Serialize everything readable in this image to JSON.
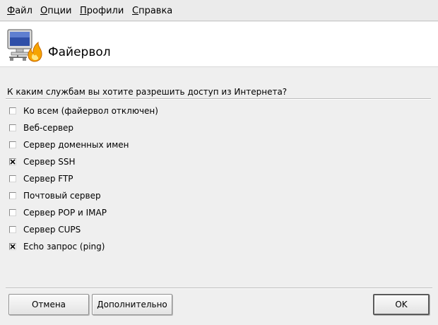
{
  "menu": {
    "items": [
      {
        "first": "Ф",
        "rest": "айл"
      },
      {
        "first": "О",
        "rest": "пции"
      },
      {
        "first": "П",
        "rest": "рофили"
      },
      {
        "first": "С",
        "rest": "правка"
      }
    ]
  },
  "header": {
    "title": "Файервол",
    "icon": "computer-with-flame-icon"
  },
  "main": {
    "question": "К каким службам вы хотите разрешить доступ из Интернета?",
    "options": [
      {
        "label": "Ко всем (файервол отключен)",
        "checked": false
      },
      {
        "label": "Веб-сервер",
        "checked": false
      },
      {
        "label": "Сервер доменных имен",
        "checked": false
      },
      {
        "label": "Сервер SSH",
        "checked": true
      },
      {
        "label": "Сервер FTP",
        "checked": false
      },
      {
        "label": "Почтовый сервер",
        "checked": false
      },
      {
        "label": "Сервер POP и IMAP",
        "checked": false
      },
      {
        "label": "Сервер CUPS",
        "checked": false
      },
      {
        "label": "Echo запрос (ping)",
        "checked": true
      }
    ]
  },
  "buttons": {
    "cancel": "Отмена",
    "advanced": "Дополнительно",
    "ok": "OK"
  },
  "colors": {
    "background": "#efefef",
    "header_background": "#ffffff",
    "flame": "#f6a400",
    "monitor_screen": "#2f4fa8"
  }
}
